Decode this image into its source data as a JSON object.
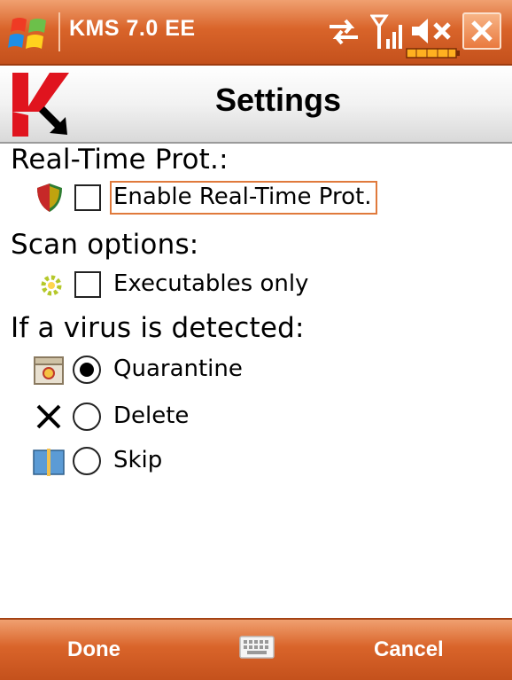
{
  "titlebar": {
    "title": "KMS 7.0 EE",
    "icons": [
      "windows-start-icon",
      "sync-icon",
      "signal-icon",
      "volume-mute-icon",
      "battery-icon",
      "close-icon"
    ]
  },
  "header": {
    "title": "Settings",
    "logo": "kaspersky-logo"
  },
  "sections": {
    "realtime": {
      "title": "Real-Time Prot.:",
      "option": {
        "label": "Enable Real-Time Prot.",
        "checked": false,
        "icon": "shield-icon"
      }
    },
    "scan": {
      "title": "Scan options:",
      "option": {
        "label": "Executables only",
        "checked": false,
        "icon": "gear-icon"
      }
    },
    "virus": {
      "title": "If a virus is detected:",
      "options": [
        {
          "label": "Quarantine",
          "selected": true,
          "icon": "quarantine-icon"
        },
        {
          "label": "Delete",
          "selected": false,
          "icon": "delete-x-icon"
        },
        {
          "label": "Skip",
          "selected": false,
          "icon": "book-icon"
        }
      ]
    }
  },
  "softkeys": {
    "left": "Done",
    "right": "Cancel",
    "center_icon": "keyboard-icon"
  },
  "colors": {
    "accent": "#d9642a",
    "focus_border": "#e07a3c"
  }
}
